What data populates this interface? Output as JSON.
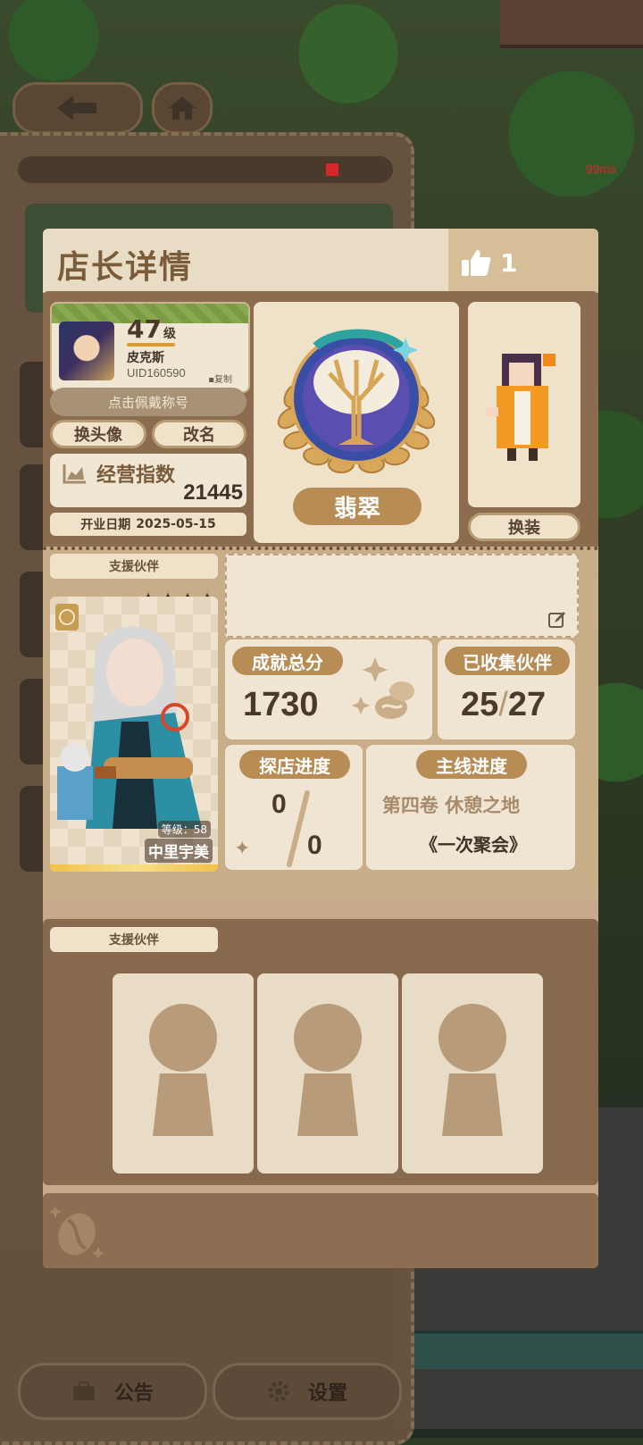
{
  "background": {
    "ping": "99ms",
    "bottom_buttons": {
      "notice": "公告",
      "settings": "设置"
    }
  },
  "modal": {
    "title": "店长详情",
    "likes": "1",
    "profile": {
      "level": "47",
      "level_unit": "级",
      "nickname": "皮克斯",
      "uid": "UID160590",
      "copy_label": "复制",
      "title_button": "点击佩戴称号",
      "change_avatar": "换头像",
      "rename": "改名",
      "business_index_label": "经营指数",
      "business_index_value": "21445",
      "open_date_label": "开业日期",
      "open_date": "2025-05-15"
    },
    "badge": {
      "name": "翡翠"
    },
    "outfit_button": "换装",
    "support": {
      "label": "支援伙伴",
      "partner": {
        "level_text": "等级：58",
        "name": "中里宇美",
        "stars": 4
      }
    },
    "stats": {
      "achievement_label": "成就总分",
      "achievement_value": "1730",
      "collected_label": "已收集伙伴",
      "collected_current": "25",
      "collected_sep": "/",
      "collected_total": "27",
      "explore_label": "探店进度",
      "explore_current": "0",
      "explore_total": "0",
      "story_label": "主线进度",
      "story_volume": "第四卷 休憩之地",
      "story_chapter": "《一次聚会》"
    },
    "support2": {
      "label": "支援伙伴",
      "slots": 3
    }
  }
}
